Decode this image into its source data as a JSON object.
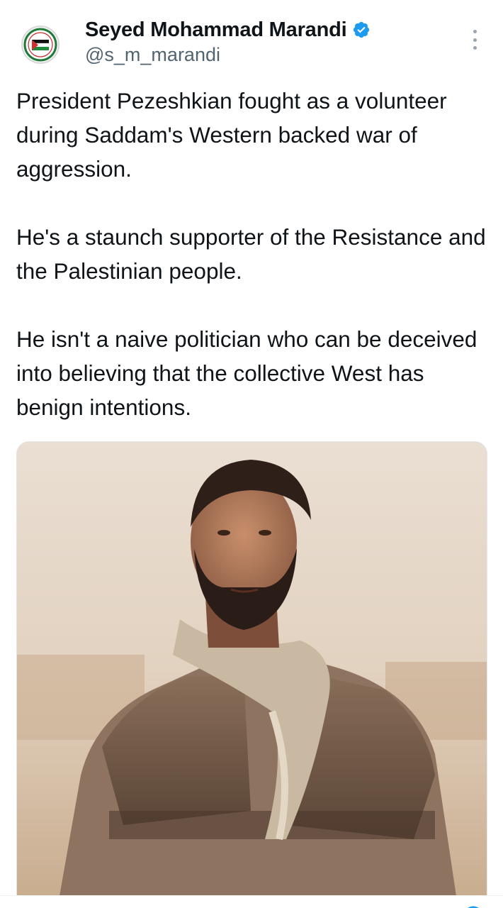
{
  "author": {
    "display_name": "Seyed Mohammad Marandi",
    "handle": "@s_m_marandi",
    "verified": true,
    "avatar_icon": "palestine-flag-badge-icon"
  },
  "tweet": {
    "paragraphs": [
      "President Pezeshkian fought as a volunteer during Saddam's Western backed war of aggression.",
      "He's a staunch supporter of the Resistance and the Palestinian people.",
      "He isn't a naive politician who can be deceived into believing that the collective West has benign intentions."
    ]
  },
  "media": {
    "type": "photo",
    "subject": "vintage photo of a bearded man in a padded vest with a scarf"
  },
  "colors": {
    "text": "#0f1419",
    "secondary_text": "#536471",
    "verified_blue": "#1d9bf0"
  }
}
